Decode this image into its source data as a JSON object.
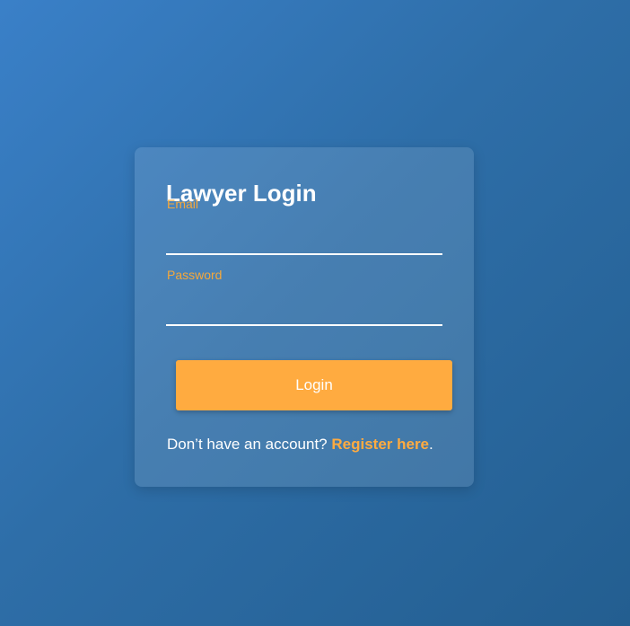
{
  "login": {
    "title": "Lawyer Login",
    "email_label": "Email",
    "email_value": "",
    "password_label": "Password",
    "password_value": "",
    "submit_label": "Login",
    "register_prompt": "Don’t have an account? ",
    "register_link": "Register here",
    "register_suffix": "."
  },
  "colors": {
    "background_start": "#3a80c8",
    "background_end": "#235e90",
    "accent": "#ffab40",
    "label": "#f6a83a",
    "text": "#ffffff"
  }
}
